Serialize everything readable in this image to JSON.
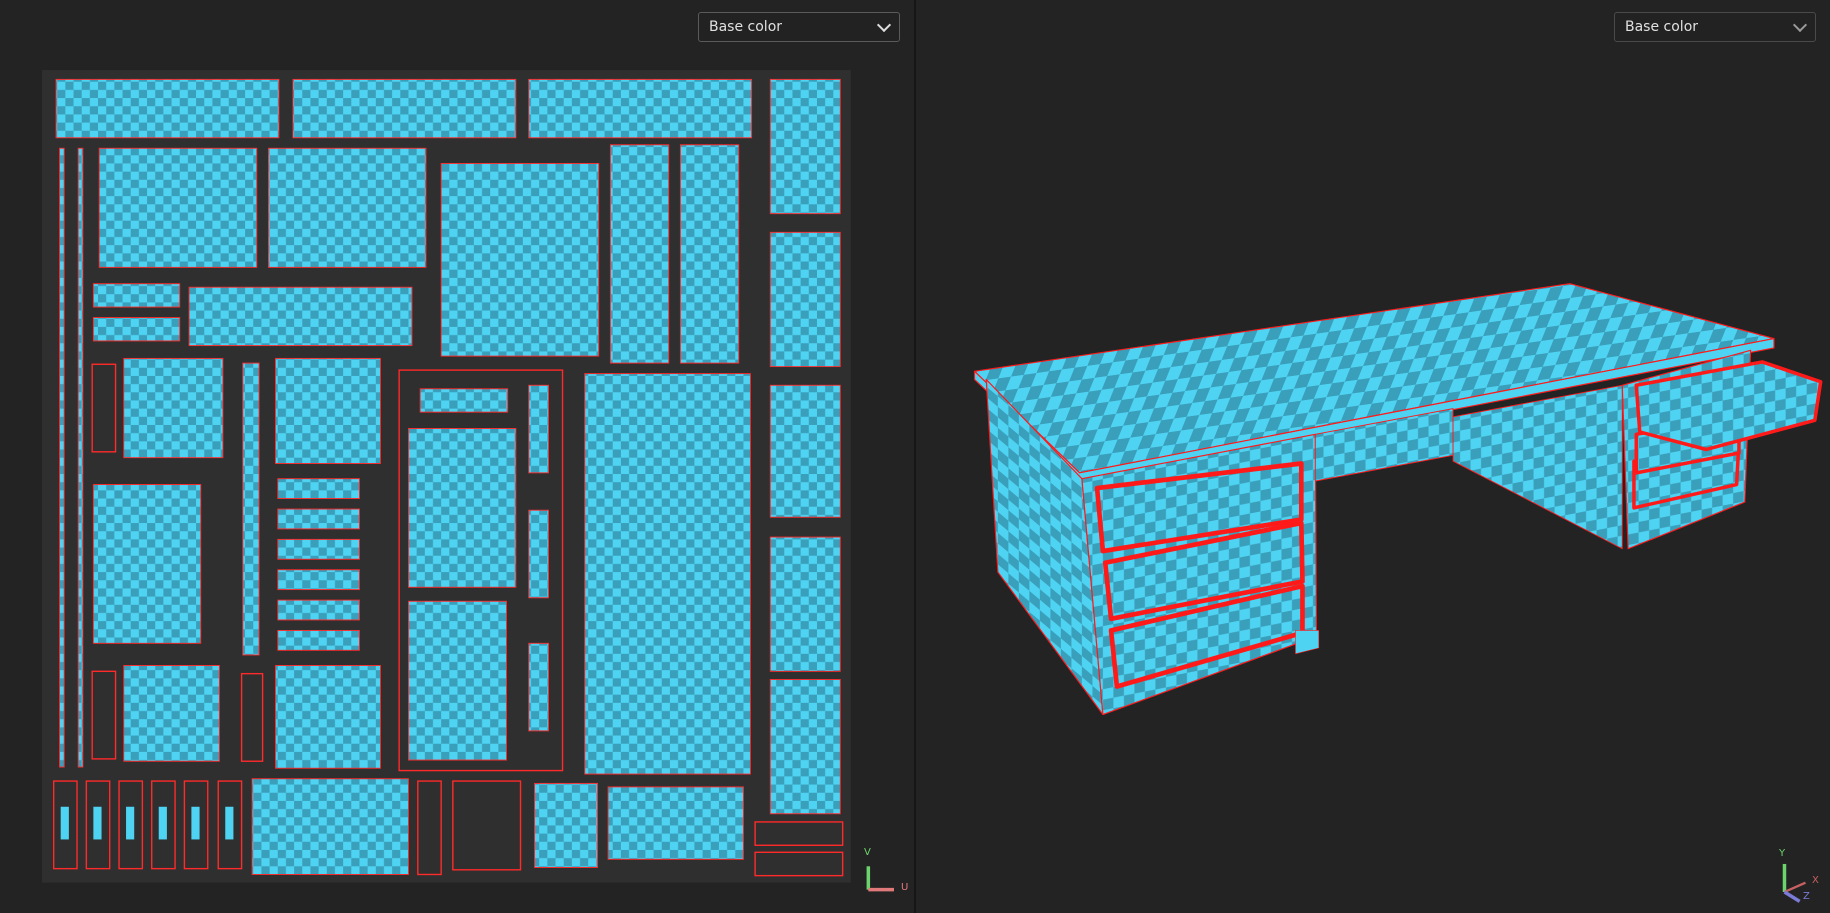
{
  "uv_editor": {
    "channel_dropdown": {
      "selected": "Base color"
    },
    "axis_gizmo": {
      "v_label": "V",
      "u_label": "U"
    }
  },
  "viewport_3d": {
    "channel_dropdown": {
      "selected": "Base color"
    },
    "axis_gizmo": {
      "y_label": "Y",
      "x_label": "X",
      "z_label": "Z"
    }
  },
  "colors": {
    "checker_light": "#4fd3f3",
    "checker_dark": "#3a9fba",
    "seam_red": "#ff2020",
    "uv_background": "#2f2f2f"
  }
}
